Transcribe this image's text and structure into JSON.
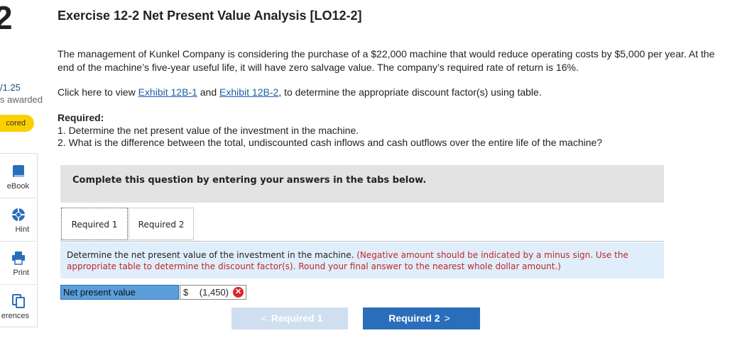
{
  "question": {
    "number": "2",
    "score": "/1.25",
    "awarded": "s awarded",
    "scored_badge": "cored"
  },
  "tools": [
    {
      "label": "eBook",
      "icon": "book-icon"
    },
    {
      "label": "Hint",
      "icon": "lifebuoy-icon"
    },
    {
      "label": "Print",
      "icon": "printer-icon"
    },
    {
      "label": "erences",
      "icon": "copy-icon"
    }
  ],
  "exercise": {
    "title": "Exercise 12-2 Net Present Value Analysis [LO12-2]",
    "intro": "The management of Kunkel Company is considering the purchase of a $22,000 machine that would reduce operating costs by $5,000 per year. At the end of the machine’s five-year useful life, it will have zero salvage value. The company’s required rate of return is 16%.",
    "click_prefix": "Click here to view ",
    "link1": "Exhibit 12B-1",
    "click_and": " and ",
    "link2": "Exhibit 12B-2",
    "click_suffix": ", to determine the appropriate discount factor(s) using table.",
    "required_heading": "Required:",
    "required_1": "1. Determine the net present value of the investment in the machine.",
    "required_2": "2. What is the difference between the total, undiscounted cash inflows and cash outflows over the entire life of the machine?"
  },
  "panel": {
    "banner": "Complete this question by entering your answers in the tabs below.",
    "tabs": [
      "Required 1",
      "Required 2"
    ],
    "instruction_main": "Determine the net present value of the investment in the machine. ",
    "instruction_red": "(Negative amount should be indicated by a minus sign. Use the appropriate table to determine the discount factor(s). Round your final answer to the nearest whole dollar amount.)",
    "answer_label": "Net present value",
    "answer_currency": "$",
    "answer_value": "(1,450)",
    "answer_status": "incorrect",
    "prev_label": "Required 1",
    "next_label": "Required 2"
  },
  "colors": {
    "accent": "#2a6ebb",
    "badge": "#fbd000",
    "error": "#d9262c",
    "link": "#1a5fa8"
  }
}
